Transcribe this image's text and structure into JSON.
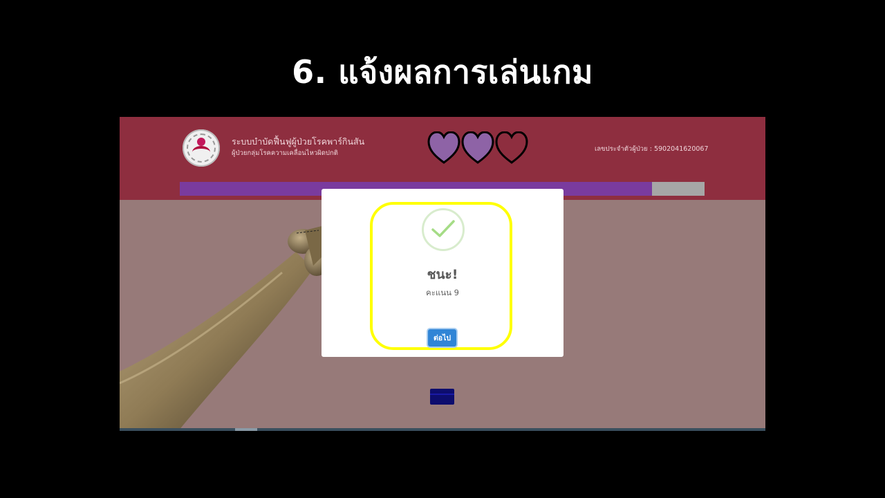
{
  "slide": {
    "title": "6. แจ้งผลการเล่นเกม"
  },
  "header": {
    "system_title": "ระบบบำบัดฟื้นฟูผู้ป่วยโรคพาร์กินสัน",
    "system_subtitle": "ผู้ป่วยกลุ่มโรคความเคลื่อนไหวผิดปกติ",
    "patient_id_label": "เลขประจำตัวผู้ป่วย : 5902041620067",
    "lives": {
      "filled": 2,
      "total": 3,
      "filled_color": "#8e63a6",
      "empty_color": "#8e2e3f"
    }
  },
  "progress": {
    "value": 0.9,
    "fill_color": "#7a3b9e",
    "track_color": "#a6a6a6"
  },
  "dialog": {
    "icon": "success-check-icon",
    "title": "ชนะ!",
    "score_text": "คะแนน 9",
    "next_button": "ต่อไป"
  },
  "colors": {
    "header_bg": "#8e2e3f",
    "scene_bg": "#977a79",
    "highlight": "#ffff00",
    "button": "#3085d6"
  }
}
